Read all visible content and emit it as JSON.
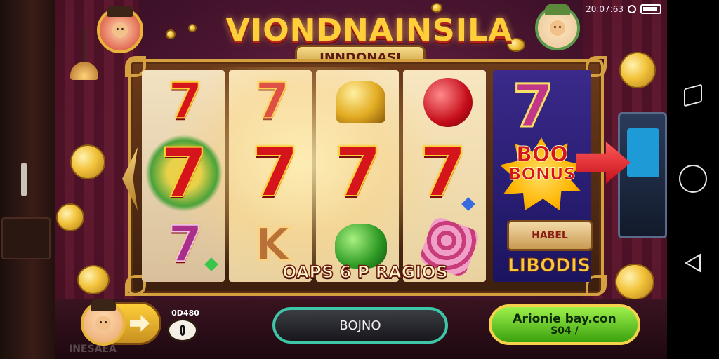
{
  "status_bar": {
    "time": "20:07:63"
  },
  "header": {
    "title": "VIONDNAINSILA",
    "subtitle": "INNDONASI"
  },
  "reels": {
    "banner": "OAPS 6 P RAGIOS",
    "col1": [
      "7",
      "7",
      "7"
    ],
    "col2": [
      "7",
      "7",
      "K"
    ],
    "col3": [
      "bell",
      "7",
      "apple"
    ],
    "col4": [
      "cherry",
      "7",
      "candy"
    ]
  },
  "bonus": {
    "line1": "BOO",
    "line2": "BONUS",
    "treasure_label": "HABEL",
    "label": "LIBODIS"
  },
  "controls": {
    "balance_label": "0D480",
    "bet_label": "BOJNO",
    "spin_line1": "Arionie bay.con",
    "spin_line2": "S04 /"
  },
  "watermark": "INESAEA",
  "colors": {
    "accent_gold": "#f6d24a",
    "spin_green": "#3aa10e",
    "bet_border": "#3ec6a8",
    "seven_red": "#d5141c"
  },
  "icons": [
    "home-icon",
    "recents-icon",
    "back-icon",
    "battery-icon",
    "arrow-right-icon"
  ]
}
